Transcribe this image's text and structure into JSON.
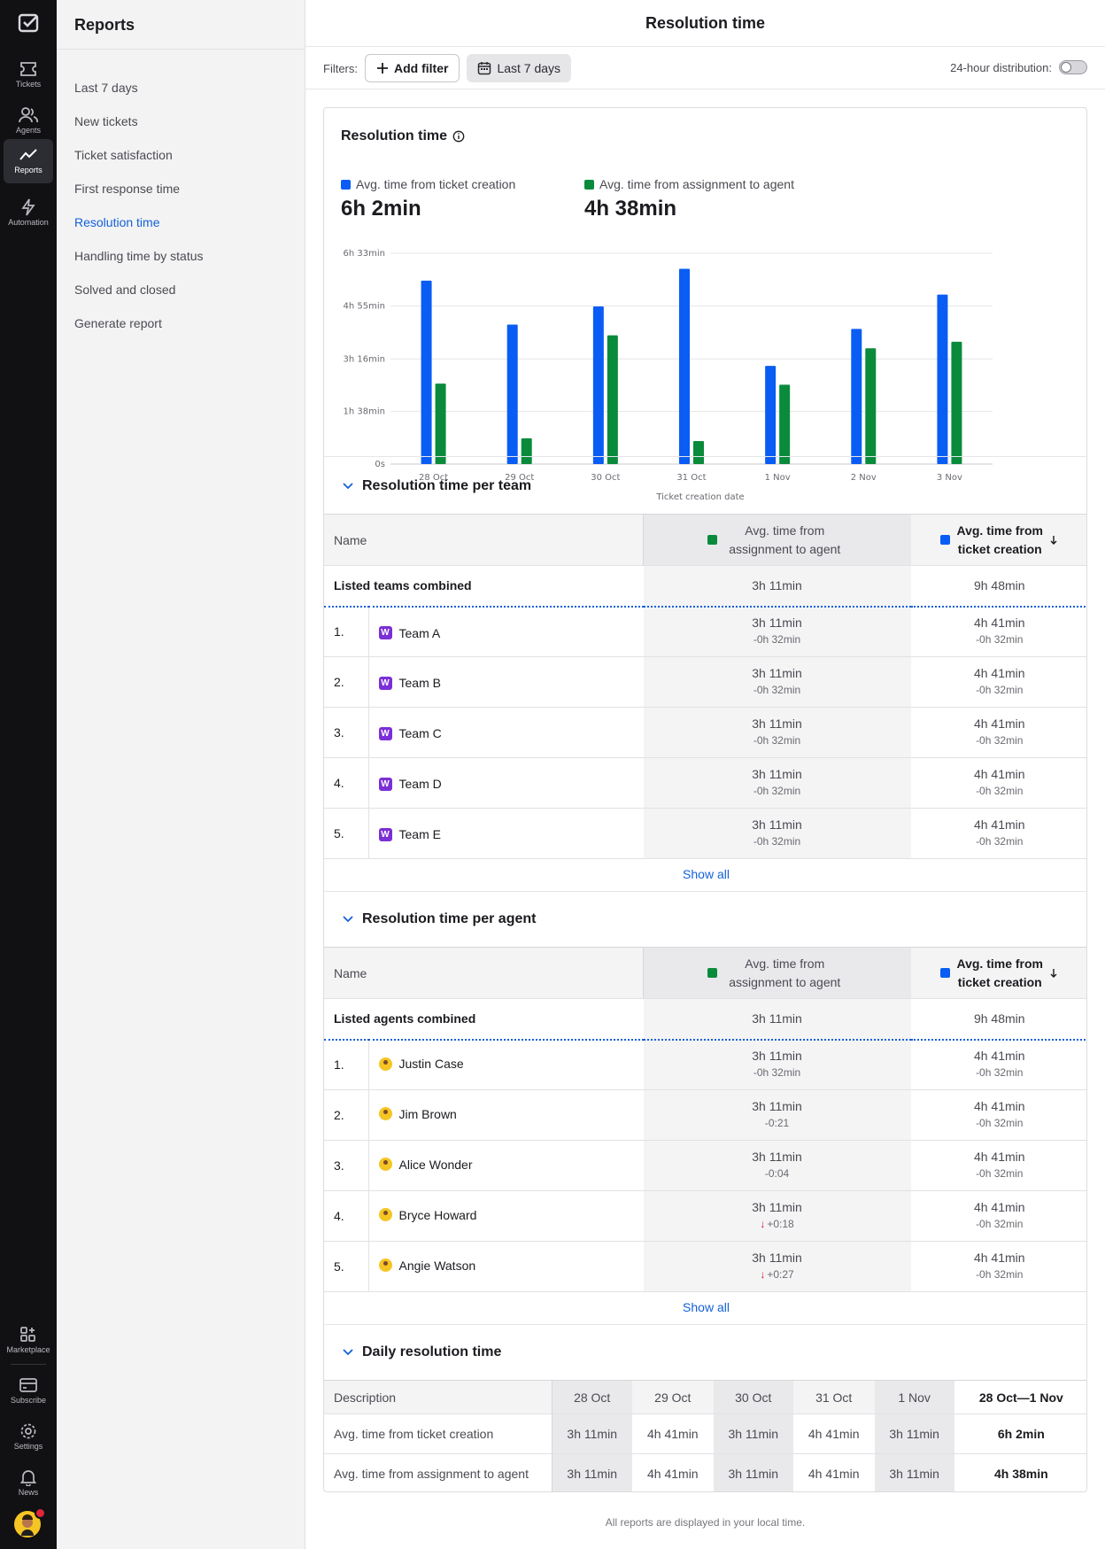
{
  "rail": {
    "items": [
      {
        "label": "Tickets",
        "icon": "ticket-icon"
      },
      {
        "label": "Agents",
        "icon": "agents-icon"
      },
      {
        "label": "Reports",
        "icon": "reports-icon",
        "active": true
      },
      {
        "label": "Automation",
        "icon": "bolt-icon"
      }
    ],
    "bottom": [
      {
        "label": "Marketplace",
        "icon": "apps-icon"
      },
      {
        "label": "Subscribe",
        "icon": "card-icon"
      },
      {
        "label": "Settings",
        "icon": "gear-icon"
      },
      {
        "label": "News",
        "icon": "bell-icon"
      }
    ]
  },
  "sidebar": {
    "title": "Reports",
    "items": [
      "Last 7 days",
      "New tickets",
      "Ticket satisfaction",
      "First response time",
      "Resolution time",
      "Handling time by status",
      "Solved and closed",
      "Generate report"
    ],
    "active": "Resolution time"
  },
  "page": {
    "title": "Resolution time",
    "filters_label": "Filters:",
    "add_filter": "Add filter",
    "date_filter": "Last 7 days",
    "distribution_label": "24-hour distribution:",
    "footnote": "All reports are displayed in your local time."
  },
  "colors": {
    "blue": "#0a5df4",
    "green": "#0a8b3c",
    "link": "#1360d8"
  },
  "summary": {
    "card_title": "Resolution time",
    "metric1_label": "Avg. time from ticket creation",
    "metric1_value": "6h 2min",
    "metric2_label": "Avg. time from assignment to agent",
    "metric2_value": "4h 38min"
  },
  "chart_data": {
    "type": "bar",
    "categories": [
      "28 Oct",
      "29 Oct",
      "30 Oct",
      "31 Oct",
      "1 Nov",
      "2 Nov",
      "3 Nov"
    ],
    "series": [
      {
        "name": "Avg. time from ticket creation",
        "color": "#0a5df4",
        "values": [
          342,
          260,
          294,
          364,
          183,
          252,
          316
        ]
      },
      {
        "name": "Avg. time from assignment to agent",
        "color": "#0a8b3c",
        "values": [
          150,
          48,
          240,
          43,
          148,
          216,
          228
        ]
      }
    ],
    "yticks": [
      "0s",
      "1h 38min",
      "3h 16min",
      "4h 55min",
      "6h 33min"
    ],
    "ytick_values": [
      0,
      98,
      196,
      295,
      393
    ],
    "ylim": [
      0,
      393
    ],
    "xlabel": "Ticket creation date",
    "ylabel": "",
    "unit": "minutes",
    "grid": true
  },
  "teams": {
    "title": "Resolution time per team",
    "col_name": "Name",
    "col_a": "Avg. time from assignment to agent",
    "col_b": "Avg. time from ticket creation",
    "combined_label": "Listed teams combined",
    "combined_a": "3h 11min",
    "combined_b": "9h 48min",
    "rows": [
      {
        "num": "1.",
        "name": "Team A",
        "a": "3h 11min",
        "a_delta": "-0h 32min",
        "b": "4h 41min",
        "b_delta": "-0h 32min"
      },
      {
        "num": "2.",
        "name": "Team B",
        "a": "3h 11min",
        "a_delta": "-0h 32min",
        "b": "4h 41min",
        "b_delta": "-0h 32min"
      },
      {
        "num": "3.",
        "name": "Team C",
        "a": "3h 11min",
        "a_delta": "-0h 32min",
        "b": "4h 41min",
        "b_delta": "-0h 32min"
      },
      {
        "num": "4.",
        "name": "Team D",
        "a": "3h 11min",
        "a_delta": "-0h 32min",
        "b": "4h 41min",
        "b_delta": "-0h 32min"
      },
      {
        "num": "5.",
        "name": "Team E",
        "a": "3h 11min",
        "a_delta": "-0h 32min",
        "b": "4h 41min",
        "b_delta": "-0h 32min"
      }
    ],
    "team_icon_letter": "W",
    "show_all": "Show all"
  },
  "agents": {
    "title": "Resolution time per agent",
    "col_name": "Name",
    "col_a": "Avg. time from assignment to agent",
    "col_b": "Avg. time from ticket creation",
    "combined_label": "Listed agents combined",
    "combined_a": "3h 11min",
    "combined_b": "9h 48min",
    "rows": [
      {
        "num": "1.",
        "name": "Justin Case",
        "a": "3h 11min",
        "a_delta": "-0h 32min",
        "a_up": false,
        "b": "4h 41min",
        "b_delta": "-0h 32min"
      },
      {
        "num": "2.",
        "name": "Jim Brown",
        "a": "3h 11min",
        "a_delta": "-0:21",
        "a_up": false,
        "b": "4h 41min",
        "b_delta": "-0h 32min"
      },
      {
        "num": "3.",
        "name": "Alice Wonder",
        "a": "3h 11min",
        "a_delta": "-0:04",
        "a_up": false,
        "b": "4h 41min",
        "b_delta": "-0h 32min"
      },
      {
        "num": "4.",
        "name": "Bryce Howard",
        "a": "3h 11min",
        "a_delta": "+0:18",
        "a_up": true,
        "b": "4h 41min",
        "b_delta": "-0h 32min"
      },
      {
        "num": "5.",
        "name": "Angie Watson",
        "a": "3h 11min",
        "a_delta": "+0:27",
        "a_up": true,
        "b": "4h 41min",
        "b_delta": "-0h 32min"
      }
    ],
    "show_all": "Show all"
  },
  "daily": {
    "title": "Daily resolution time",
    "col_desc": "Description",
    "cols": [
      "28 Oct",
      "29 Oct",
      "30 Oct",
      "31 Oct",
      "1 Nov",
      "28 Oct—1 Nov"
    ],
    "rows": [
      {
        "label": "Avg. time from ticket creation",
        "values": [
          "3h 11min",
          "4h 41min",
          "3h 11min",
          "4h 41min",
          "3h 11min",
          "6h 2min"
        ]
      },
      {
        "label": "Avg. time from assignment to agent",
        "values": [
          "3h 11min",
          "4h 41min",
          "3h 11min",
          "4h 41min",
          "3h 11min",
          "4h 38min"
        ]
      }
    ]
  }
}
